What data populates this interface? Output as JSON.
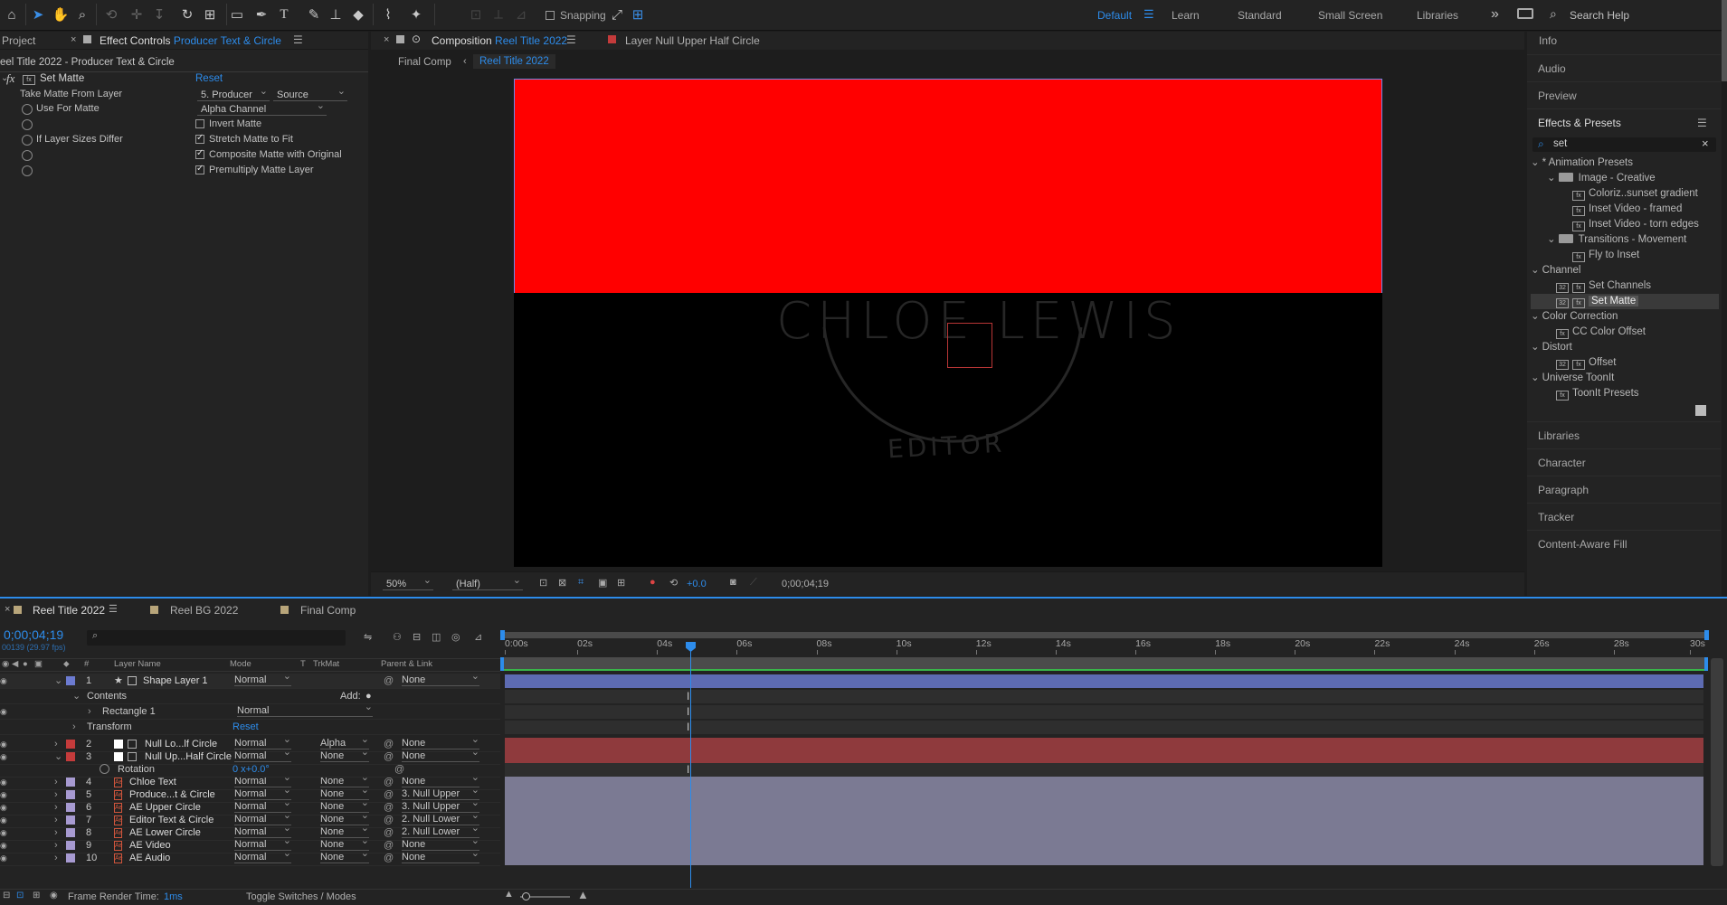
{
  "toolbar": {
    "snapping": "Snapping",
    "workspaces": [
      "Default",
      "Learn",
      "Standard",
      "Small Screen",
      "Libraries"
    ],
    "search_help": "Search Help",
    "overflow": "»"
  },
  "left_tabs": {
    "project": "Project",
    "effect_controls": "Effect Controls",
    "effect_controls_target": "Producer Text & Circle"
  },
  "effect_controls": {
    "path": "eel Title 2022 - Producer Text & Circle",
    "effect_name": "Set Matte",
    "reset": "Reset",
    "take_matte_label": "Take Matte From Layer",
    "take_matte_layer": "5. Producer",
    "take_matte_source": "Source",
    "use_for_matte_label": "Use For Matte",
    "use_for_matte_value": "Alpha Channel",
    "invert_matte": "Invert Matte",
    "if_sizes_differ_label": "If Layer Sizes Differ",
    "stretch": "Stretch Matte to Fit",
    "composite": "Composite Matte with Original",
    "premultiply": "Premultiply Matte Layer",
    "checked": {
      "invert": false,
      "stretch": true,
      "composite": true,
      "premultiply": true
    }
  },
  "comp_tabs": {
    "composition_prefix": "Composition",
    "composition_name": "Reel Title 2022",
    "layer_prefix": "Layer",
    "layer_name": "Null Upper Half Circle",
    "crumb_final": "Final Comp",
    "crumb_current": "Reel Title 2022"
  },
  "viewer": {
    "headline": "CHLOE LEWIS",
    "subline": "EDITOR",
    "red": "#ff0000"
  },
  "viewer_footer": {
    "zoom": "50%",
    "resolution": "(Half)",
    "exposure": "+0.0",
    "timecode": "0;00;04;19"
  },
  "right_panel": {
    "info": "Info",
    "audio": "Audio",
    "preview": "Preview",
    "effects_presets": "Effects & Presets",
    "search_value": "set",
    "libraries": "Libraries",
    "character": "Character",
    "paragraph": "Paragraph",
    "tracker": "Tracker",
    "content_aware": "Content-Aware Fill"
  },
  "effects_tree": [
    {
      "label": "* Animation Presets",
      "kind": "group",
      "indent": 0
    },
    {
      "label": "Image - Creative",
      "kind": "folder",
      "indent": 1
    },
    {
      "label": "Coloriz..sunset gradient",
      "kind": "preset",
      "indent": 2
    },
    {
      "label": "Inset Video - framed",
      "kind": "preset",
      "indent": 2
    },
    {
      "label": "Inset Video - torn edges",
      "kind": "preset",
      "indent": 2
    },
    {
      "label": "Transitions - Movement",
      "kind": "folder",
      "indent": 1
    },
    {
      "label": "Fly to Inset",
      "kind": "preset",
      "indent": 2
    },
    {
      "label": "Channel",
      "kind": "group",
      "indent": 0
    },
    {
      "label": "Set Channels",
      "kind": "effect",
      "indent": 1
    },
    {
      "label": "Set Matte",
      "kind": "effect",
      "indent": 1,
      "selected": true
    },
    {
      "label": "Color Correction",
      "kind": "group",
      "indent": 0
    },
    {
      "label": "CC Color Offset",
      "kind": "effect1",
      "indent": 1
    },
    {
      "label": "Distort",
      "kind": "group",
      "indent": 0
    },
    {
      "label": "Offset",
      "kind": "effect",
      "indent": 1
    },
    {
      "label": "Universe ToonIt",
      "kind": "group",
      "indent": 0
    },
    {
      "label": "ToonIt Presets",
      "kind": "effect1",
      "indent": 1
    }
  ],
  "timeline_tabs": {
    "t1": "Reel Title 2022",
    "t2": "Reel BG 2022",
    "t3": "Final Comp"
  },
  "timeline": {
    "timecode": "0;00;04;19",
    "fps": "00139 (29.97 fps)",
    "col_layer_name": "Layer Name",
    "col_mode": "Mode",
    "col_t": "T",
    "col_trkmat": "TrkMat",
    "col_parent": "Parent & Link",
    "col_hash": "#",
    "add_label": "Add:",
    "transform": "Transform",
    "transform_reset": "Reset",
    "contents": "Contents",
    "rectangle": "Rectangle 1",
    "rect_mode": "Normal",
    "rotation_label": "Rotation",
    "rotation_value": "0 x+0.0°",
    "frame_render_label": "Frame Render Time:",
    "frame_render_value": "1ms",
    "toggle_label": "Toggle Switches / Modes"
  },
  "ruler": [
    "0:00s",
    "02s",
    "04s",
    "06s",
    "08s",
    "10s",
    "12s",
    "14s",
    "16s",
    "18s",
    "20s",
    "22s",
    "24s",
    "26s",
    "28s",
    "30s"
  ],
  "layers": [
    {
      "num": "1",
      "name": "Shape Layer 1",
      "mode": "Normal",
      "trkmat": "",
      "parent": "None",
      "color": "#6c7bd1",
      "bar": "#5d6bb2",
      "kind": "shape"
    },
    {
      "num": "2",
      "name": "Null Lo...lf Circle",
      "mode": "Normal",
      "trkmat": "Alpha",
      "parent": "None",
      "color": "#c43b3b",
      "bar": "#8f3a3d",
      "kind": "null"
    },
    {
      "num": "3",
      "name": "Null Up...Half Circle",
      "mode": "Normal",
      "trkmat": "None",
      "parent": "None",
      "color": "#c43b3b",
      "bar": "#8f3a3d",
      "kind": "null"
    },
    {
      "num": "4",
      "name": "Chloe Text",
      "mode": "Normal",
      "trkmat": "None",
      "parent": "None",
      "color": "#a79ad1",
      "bar": "#7b7a93",
      "kind": "ae"
    },
    {
      "num": "5",
      "name": "Produce...t & Circle",
      "mode": "Normal",
      "trkmat": "None",
      "parent": "3. Null Upper",
      "color": "#a79ad1",
      "bar": "#7b7a93",
      "kind": "ae"
    },
    {
      "num": "6",
      "name": "AE Upper Circle",
      "mode": "Normal",
      "trkmat": "None",
      "parent": "3. Null Upper",
      "color": "#a79ad1",
      "bar": "#7b7a93",
      "kind": "ae"
    },
    {
      "num": "7",
      "name": "Editor Text & Circle",
      "mode": "Normal",
      "trkmat": "None",
      "parent": "2. Null Lower",
      "color": "#a79ad1",
      "bar": "#7b7a93",
      "kind": "ae"
    },
    {
      "num": "8",
      "name": "AE Lower Circle",
      "mode": "Normal",
      "trkmat": "None",
      "parent": "2. Null Lower",
      "color": "#a79ad1",
      "bar": "#7b7a93",
      "kind": "ae"
    },
    {
      "num": "9",
      "name": "AE Video",
      "mode": "Normal",
      "trkmat": "None",
      "parent": "None",
      "color": "#a79ad1",
      "bar": "#7b7a93",
      "kind": "ae"
    },
    {
      "num": "10",
      "name": "AE Audio",
      "mode": "Normal",
      "trkmat": "None",
      "parent": "None",
      "color": "#a79ad1",
      "bar": "#7b7a93",
      "kind": "ae"
    }
  ]
}
